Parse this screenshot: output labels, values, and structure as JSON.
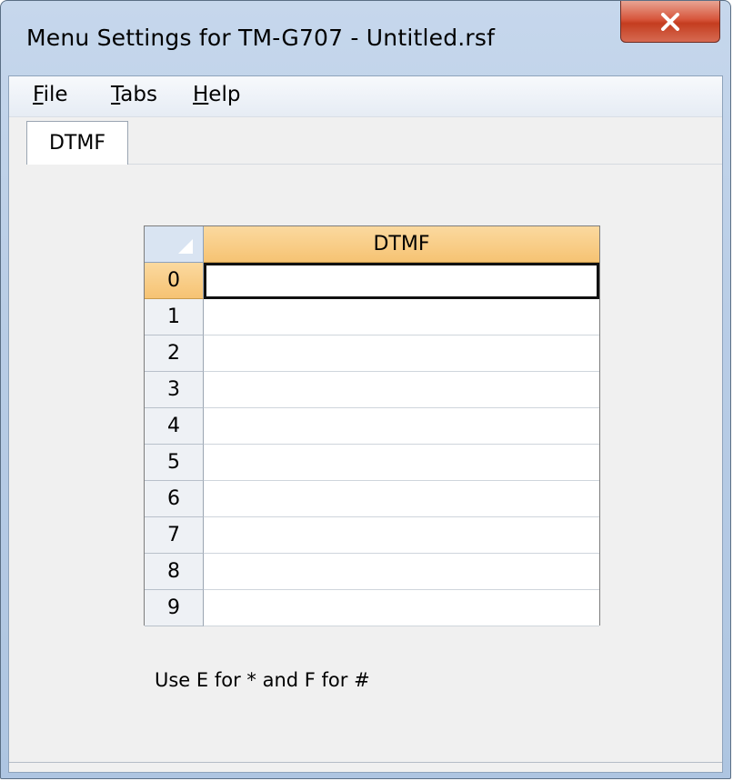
{
  "window": {
    "title": "Menu Settings for TM-G707 - Untitled.rsf",
    "close_icon": "close-icon"
  },
  "menu": {
    "items": [
      {
        "accel": "F",
        "rest": "ile"
      },
      {
        "accel": "T",
        "rest": "abs"
      },
      {
        "accel": "H",
        "rest": "elp"
      }
    ]
  },
  "tabs": [
    {
      "label": "DTMF",
      "selected": true
    }
  ],
  "grid": {
    "column_header": "DTMF",
    "selected_row": 0,
    "rows": [
      {
        "label": "0",
        "value": ""
      },
      {
        "label": "1",
        "value": ""
      },
      {
        "label": "2",
        "value": ""
      },
      {
        "label": "3",
        "value": ""
      },
      {
        "label": "4",
        "value": ""
      },
      {
        "label": "5",
        "value": ""
      },
      {
        "label": "6",
        "value": ""
      },
      {
        "label": "7",
        "value": ""
      },
      {
        "label": "8",
        "value": ""
      },
      {
        "label": "9",
        "value": ""
      }
    ]
  },
  "note": "Use E for * and F for #",
  "colors": {
    "header_accent": "#f6c373",
    "close_button": "#c43d1f"
  }
}
